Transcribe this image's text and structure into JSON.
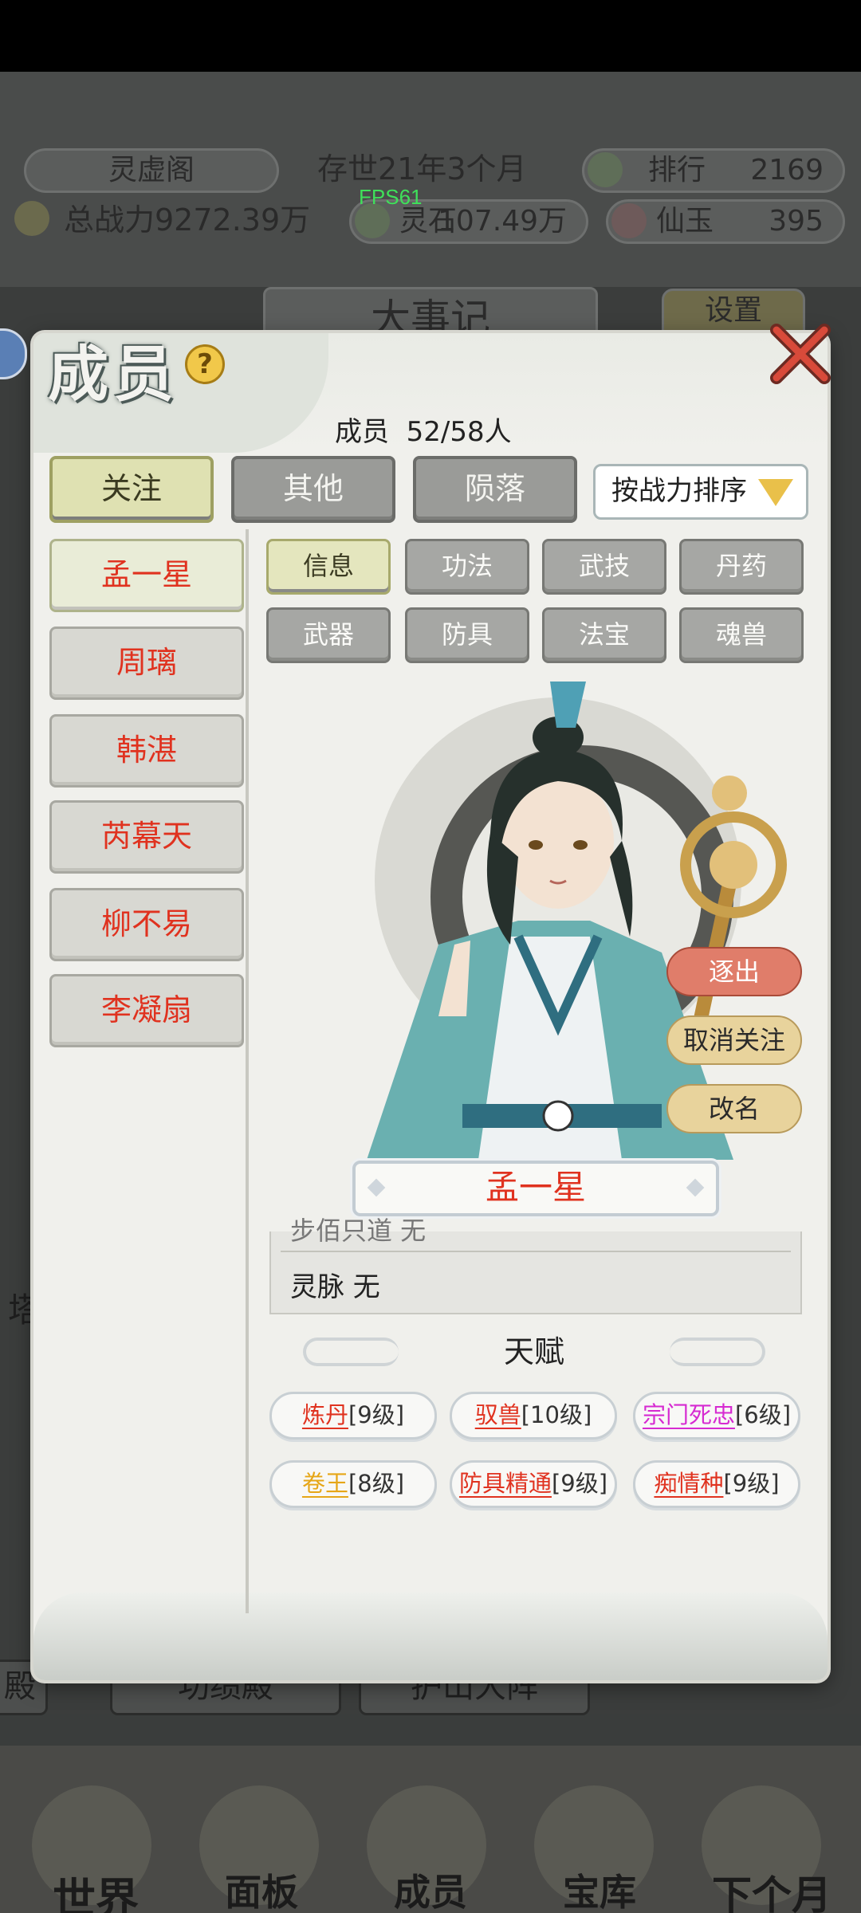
{
  "header": {
    "sect_name": "灵虚阁",
    "years": "存世21年3个月",
    "rank_label": "排行",
    "rank_value": "2169",
    "power_label": "总战力9272.39万",
    "spirit_stone_label": "灵石",
    "spirit_stone_value": "107.49万",
    "jade_label": "仙玉",
    "jade_value": "395",
    "fps": "FPS61"
  },
  "background": {
    "events_title": "大事记",
    "settings": "设置",
    "btn_left_partial": "殿",
    "btn_merit_hall": "功绩殿",
    "btn_array": "护山大阵",
    "left_edge_char": "塔"
  },
  "bottom_nav": [
    "世界",
    "面板",
    "成员",
    "宝库",
    "下个月"
  ],
  "dialog": {
    "title": "成员",
    "help": "?",
    "member_count": "成员  52/58人",
    "tabs": [
      "关注",
      "其他",
      "陨落"
    ],
    "sort_label": "按战力排序",
    "members": [
      "孟一星",
      "周璃",
      "韩湛",
      "芮幕天",
      "柳不易",
      "李凝扇"
    ],
    "subtabs_row1": [
      "信息",
      "功法",
      "武技",
      "丹药"
    ],
    "subtabs_row2": [
      "武器",
      "防具",
      "法宝",
      "魂兽"
    ],
    "actions": {
      "expel": "逐出",
      "unfollow": "取消关注",
      "rename": "改名"
    },
    "selected_name": "孟一星",
    "info_partial_line": "步佰只道 无",
    "spirit_vein": "灵脉 无",
    "talent_title": "天赋",
    "talents": [
      {
        "name": "炼丹",
        "level": "[9级]",
        "color": "#e0321f"
      },
      {
        "name": "驭兽",
        "level": "[10级]",
        "color": "#e0321f"
      },
      {
        "name": "宗门死忠",
        "level": "[6级]",
        "color": "#d62ad1"
      },
      {
        "name": "卷王",
        "level": "[8级]",
        "color": "#e6a617"
      },
      {
        "name": "防具精通",
        "level": "[9级]",
        "color": "#e0321f"
      },
      {
        "name": "痴情种",
        "level": "[9级]",
        "color": "#e0321f"
      }
    ]
  }
}
